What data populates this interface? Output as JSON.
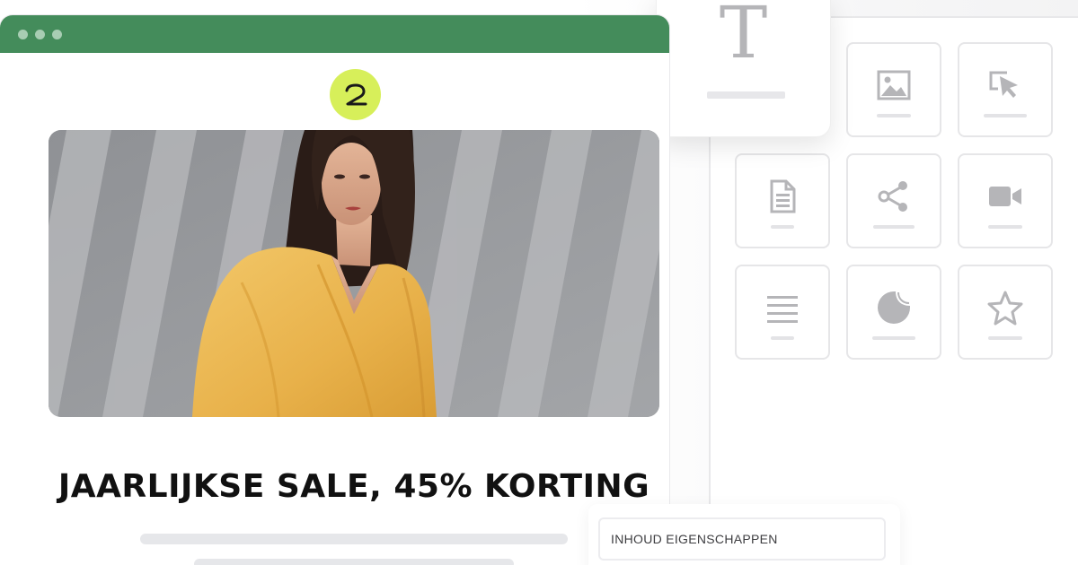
{
  "email": {
    "headline": "JAARLIJKSE SALE, 45% KORTING",
    "logo_icon": "brand-logo-icon",
    "hero_image": "woman-in-yellow-blouse-photo"
  },
  "properties_tab": {
    "label": "INHOUD EIGENSCHAPPEN"
  },
  "builder": {
    "text_block_icon": "text-block-icon",
    "blocks": [
      {
        "icon": "image-icon"
      },
      {
        "icon": "button-cursor-icon"
      },
      {
        "icon": "document-icon"
      },
      {
        "icon": "share-icon"
      },
      {
        "icon": "video-icon"
      },
      {
        "icon": "divider-lines-icon"
      },
      {
        "icon": "sticker-icon"
      },
      {
        "icon": "star-icon"
      }
    ]
  },
  "colors": {
    "window_bar": "#448c5b",
    "logo_badge": "#d7ef5a",
    "icon_gray": "#b5b5b8"
  }
}
